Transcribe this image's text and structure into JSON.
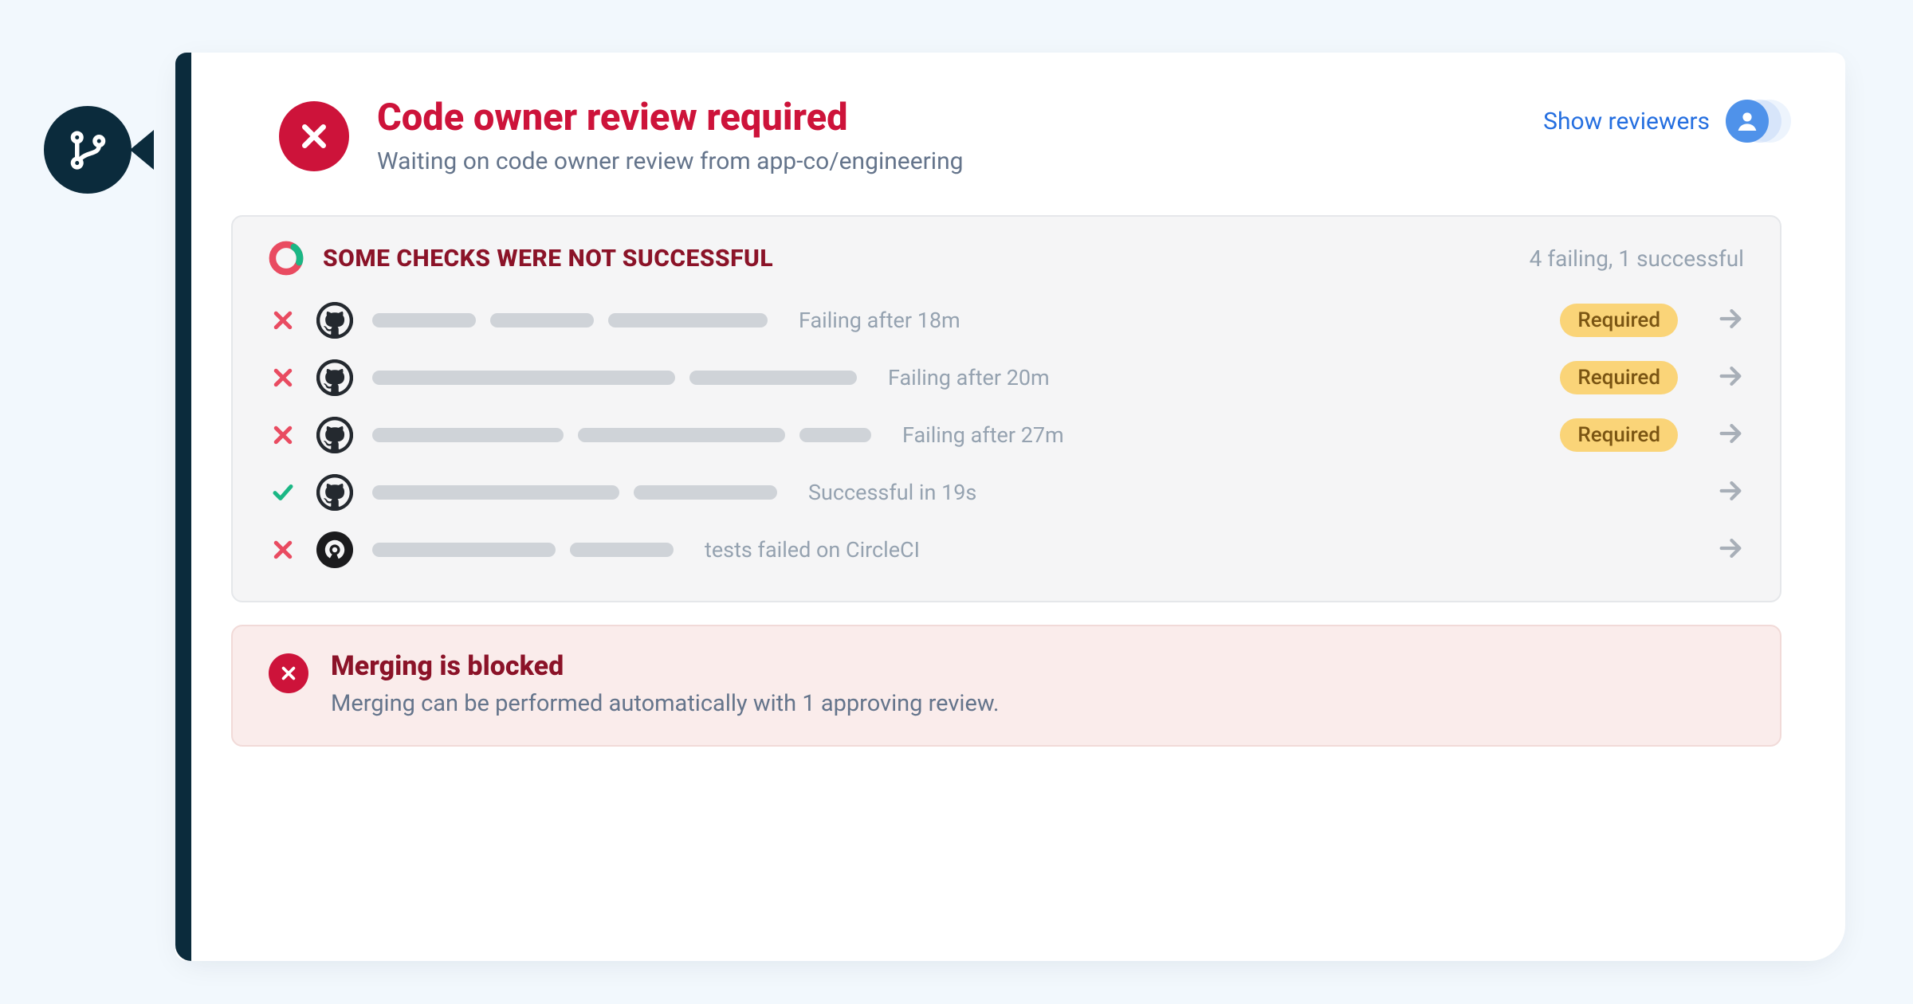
{
  "header": {
    "title": "Code owner review required",
    "subtitle": "Waiting on code owner review from app-co/engineering",
    "show_reviewers": "Show reviewers"
  },
  "checks": {
    "title": "SOME CHECKS WERE NOT SUCCESSFUL",
    "summary": "4 failing, 1 successful",
    "required_label": "Required",
    "items": [
      {
        "status": "fail",
        "provider": "github",
        "bars": [
          130,
          130,
          200
        ],
        "message": "Failing after 18m",
        "required": true
      },
      {
        "status": "fail",
        "provider": "github",
        "bars": [
          380,
          210
        ],
        "message": "Failing after 20m",
        "required": true
      },
      {
        "status": "fail",
        "provider": "github",
        "bars": [
          240,
          260,
          90
        ],
        "message": "Failing after 27m",
        "required": true
      },
      {
        "status": "pass",
        "provider": "github",
        "bars": [
          310,
          180
        ],
        "message": "Successful in 19s",
        "required": false
      },
      {
        "status": "fail",
        "provider": "circleci",
        "bars": [
          230,
          130
        ],
        "message": "tests failed on CircleCI",
        "required": false
      }
    ]
  },
  "blocked": {
    "title": "Merging is blocked",
    "subtitle": "Merging can be performed automatically with 1 approving review."
  },
  "colors": {
    "crimson": "#cd133a",
    "link": "#256fe0",
    "pill": "#fad478",
    "green": "#1bb785"
  }
}
